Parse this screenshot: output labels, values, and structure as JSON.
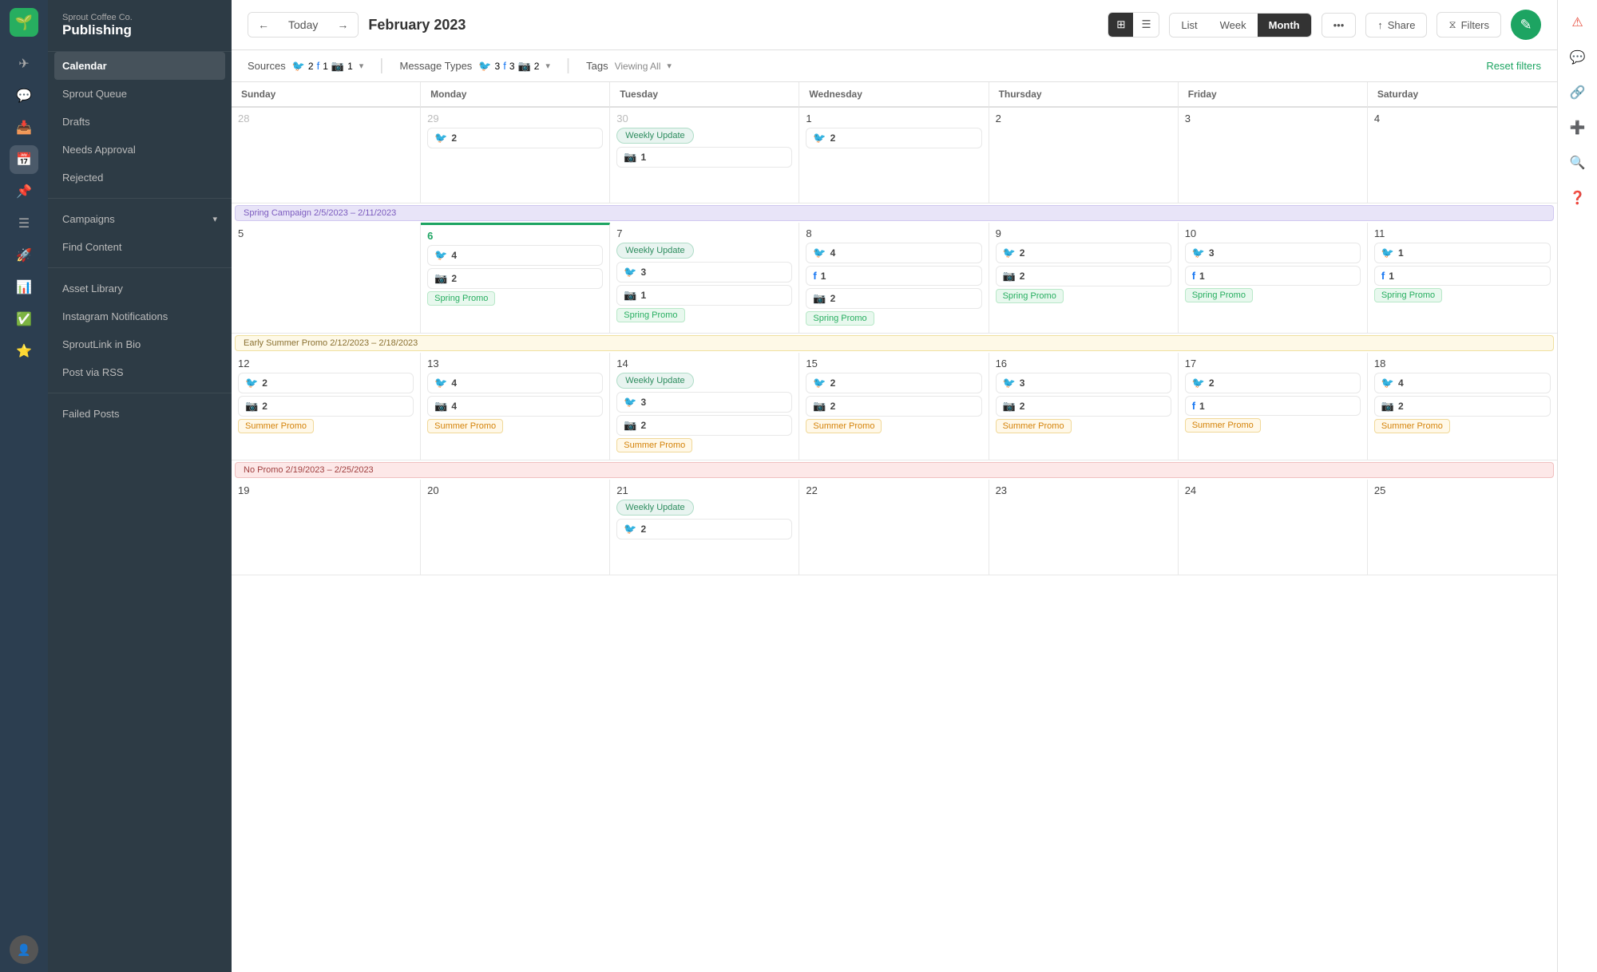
{
  "brand": {
    "company": "Sprout Coffee Co.",
    "product": "Publishing"
  },
  "sidebar": {
    "items": [
      {
        "id": "calendar",
        "label": "Calendar",
        "active": true
      },
      {
        "id": "sprout-queue",
        "label": "Sprout Queue"
      },
      {
        "id": "drafts",
        "label": "Drafts"
      },
      {
        "id": "needs-approval",
        "label": "Needs Approval"
      },
      {
        "id": "rejected",
        "label": "Rejected"
      },
      {
        "id": "campaigns",
        "label": "Campaigns",
        "hasChevron": true
      },
      {
        "id": "find-content",
        "label": "Find Content"
      },
      {
        "id": "asset-library",
        "label": "Asset Library"
      },
      {
        "id": "instagram-notifications",
        "label": "Instagram Notifications"
      },
      {
        "id": "sproutlink",
        "label": "SproutLink in Bio"
      },
      {
        "id": "post-rss",
        "label": "Post via RSS"
      },
      {
        "id": "failed-posts",
        "label": "Failed Posts"
      }
    ]
  },
  "toolbar": {
    "today_label": "Today",
    "page_title": "February 2023",
    "view_list": "List",
    "view_week": "Week",
    "view_month": "Month",
    "share_label": "Share",
    "filters_label": "Filters"
  },
  "filters": {
    "sources_label": "Sources",
    "sources_icons": [
      "tw:2",
      "fb:1",
      "ig:1"
    ],
    "message_types_label": "Message Types",
    "message_icons": [
      "tw:3",
      "fb:3",
      "ig:2"
    ],
    "tags_label": "Tags",
    "tags_value": "Viewing All",
    "reset_label": "Reset filters"
  },
  "days_of_week": [
    "Sunday",
    "Monday",
    "Tuesday",
    "Wednesday",
    "Thursday",
    "Friday",
    "Saturday"
  ],
  "weeks": [
    {
      "cells": [
        {
          "num": "28",
          "other": true,
          "posts": []
        },
        {
          "num": "29",
          "other": true,
          "posts": [
            {
              "type": "tw",
              "count": 2
            }
          ]
        },
        {
          "num": "30",
          "other": true,
          "weekly_update": true,
          "posts": [
            {
              "type": "ig",
              "count": 1
            }
          ]
        },
        {
          "num": "1",
          "posts": [
            {
              "type": "tw",
              "count": 2
            }
          ]
        },
        {
          "num": "2",
          "posts": []
        },
        {
          "num": "3",
          "posts": []
        },
        {
          "num": "4",
          "posts": []
        }
      ]
    },
    {
      "campaign": {
        "label": "Spring Campaign 2/5/2023 – 2/11/2023",
        "color": "purple"
      },
      "cells": [
        {
          "num": "5",
          "posts": []
        },
        {
          "num": "6",
          "today": true,
          "posts": [
            {
              "type": "tw",
              "count": 4
            },
            {
              "type": "ig",
              "count": 2
            },
            {
              "tag": "Spring Promo",
              "tagType": "spring"
            }
          ]
        },
        {
          "num": "7",
          "weekly_update": true,
          "posts": [
            {
              "type": "tw",
              "count": 3
            },
            {
              "type": "ig",
              "count": 1
            },
            {
              "tag": "Spring Promo",
              "tagType": "spring"
            }
          ]
        },
        {
          "num": "8",
          "posts": [
            {
              "type": "tw",
              "count": 4
            },
            {
              "type": "fb",
              "count": 1
            },
            {
              "type": "ig",
              "count": 2
            },
            {
              "tag": "Spring Promo",
              "tagType": "spring"
            }
          ]
        },
        {
          "num": "9",
          "posts": [
            {
              "type": "tw",
              "count": 2
            },
            {
              "type": "ig",
              "count": 2
            },
            {
              "tag": "Spring Promo",
              "tagType": "spring"
            }
          ]
        },
        {
          "num": "10",
          "posts": [
            {
              "type": "tw",
              "count": 3
            },
            {
              "type": "fb",
              "count": 1
            },
            {
              "tag": "Spring Promo",
              "tagType": "spring"
            }
          ]
        },
        {
          "num": "11",
          "posts": [
            {
              "type": "tw",
              "count": 1
            },
            {
              "type": "fb",
              "count": 1
            },
            {
              "tag": "Spring Promo",
              "tagType": "spring"
            }
          ]
        }
      ]
    },
    {
      "campaign": {
        "label": "Early Summer Promo 2/12/2023 – 2/18/2023",
        "color": "yellow"
      },
      "cells": [
        {
          "num": "12",
          "posts": [
            {
              "type": "tw",
              "count": 2
            },
            {
              "type": "ig",
              "count": 2
            },
            {
              "tag": "Summer Promo",
              "tagType": "summer"
            }
          ]
        },
        {
          "num": "13",
          "posts": [
            {
              "type": "tw",
              "count": 4
            },
            {
              "type": "ig",
              "count": 4
            },
            {
              "tag": "Summer Promo",
              "tagType": "summer"
            }
          ]
        },
        {
          "num": "14",
          "weekly_update": true,
          "posts": [
            {
              "type": "tw",
              "count": 3
            },
            {
              "type": "ig",
              "count": 2
            },
            {
              "tag": "Summer Promo",
              "tagType": "summer"
            }
          ]
        },
        {
          "num": "15",
          "posts": [
            {
              "type": "tw",
              "count": 2
            },
            {
              "type": "ig",
              "count": 2
            },
            {
              "tag": "Summer Promo",
              "tagType": "summer"
            }
          ]
        },
        {
          "num": "16",
          "posts": [
            {
              "type": "tw",
              "count": 3
            },
            {
              "type": "ig",
              "count": 2
            },
            {
              "tag": "Summer Promo",
              "tagType": "summer"
            }
          ]
        },
        {
          "num": "17",
          "posts": [
            {
              "type": "tw",
              "count": 2
            },
            {
              "type": "fb",
              "count": 1
            },
            {
              "tag": "Summer Promo",
              "tagType": "summer"
            }
          ]
        },
        {
          "num": "18",
          "posts": [
            {
              "type": "tw",
              "count": 4
            },
            {
              "type": "ig",
              "count": 2
            },
            {
              "tag": "Summer Promo",
              "tagType": "summer"
            }
          ]
        }
      ]
    },
    {
      "campaign": {
        "label": "No Promo 2/19/2023 – 2/25/2023",
        "color": "red"
      },
      "cells": [
        {
          "num": "19",
          "posts": []
        },
        {
          "num": "20",
          "posts": []
        },
        {
          "num": "21",
          "weekly_update": true,
          "posts": [
            {
              "type": "tw",
              "count": 2
            }
          ]
        },
        {
          "num": "22",
          "posts": []
        },
        {
          "num": "23",
          "posts": []
        },
        {
          "num": "24",
          "posts": []
        },
        {
          "num": "25",
          "posts": []
        }
      ]
    }
  ],
  "weekly_update_label": "Weekly Update",
  "icons": {
    "twitter": "🐦",
    "instagram": "📷",
    "facebook": "f",
    "compose": "✎",
    "alert": "⚠",
    "messages": "💬",
    "link": "🔗",
    "add": "+",
    "search": "🔍",
    "help": "?"
  }
}
